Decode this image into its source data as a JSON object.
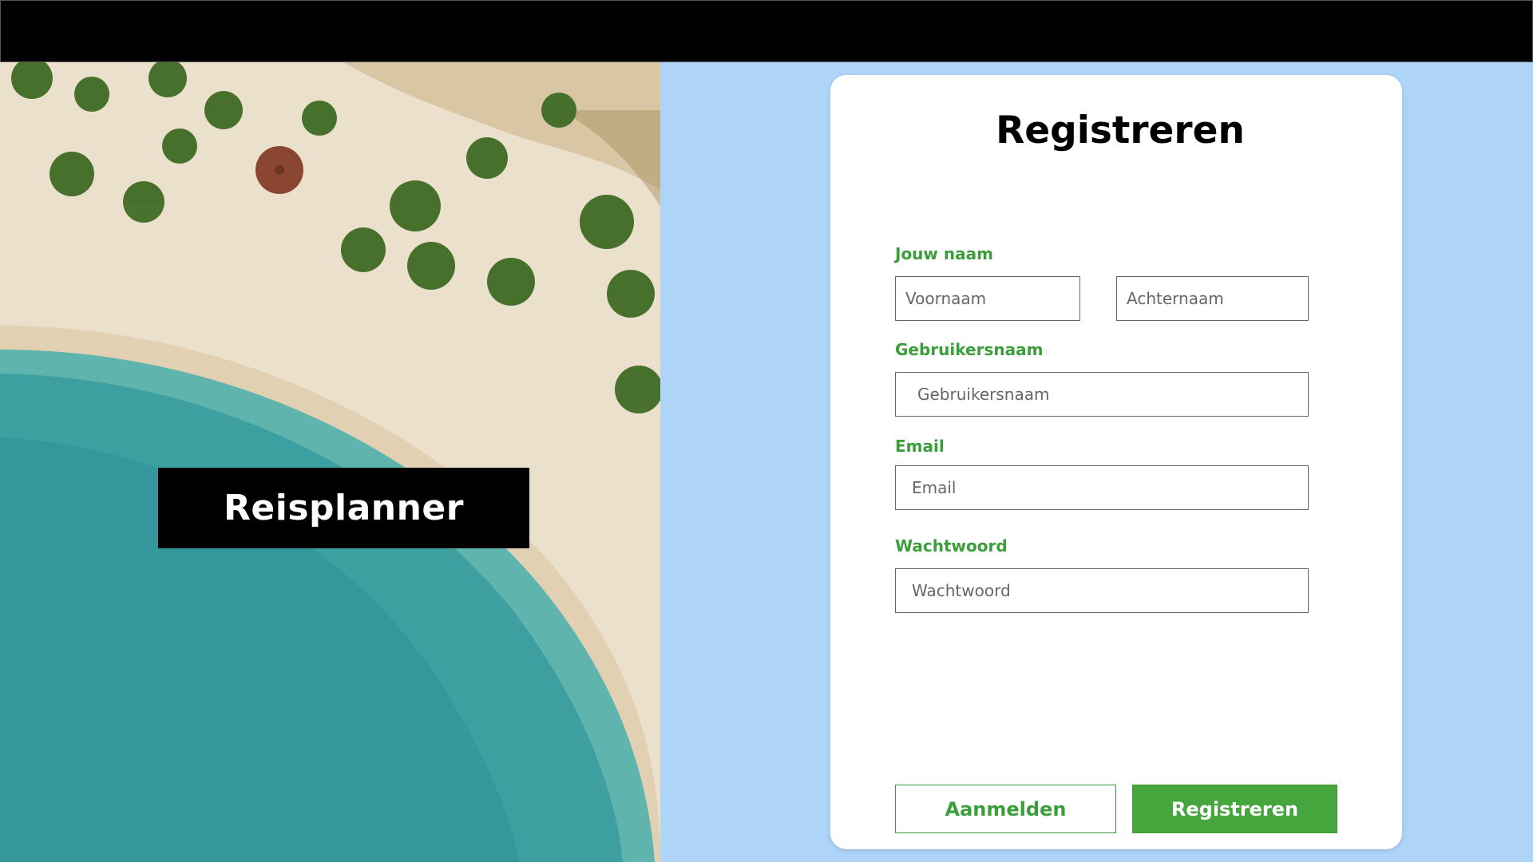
{
  "hero": {
    "brand_label": "Reisplanner"
  },
  "form": {
    "title": "Registreren",
    "name_label": "Jouw naam",
    "firstname_placeholder": "Voornaam",
    "lastname_placeholder": "Achternaam",
    "username_label": "Gebruikersnaam",
    "username_placeholder": "Gebruikersnaam",
    "email_label": "Email",
    "email_placeholder": "Email",
    "password_label": "Wachtwoord",
    "password_placeholder": "Wachtwoord",
    "login_button": "Aanmelden",
    "register_button": "Registreren"
  },
  "colors": {
    "accent_green": "#46a63e",
    "label_green": "#3c9e3a",
    "page_background": "#aed4f7",
    "topbar": "#000000"
  }
}
